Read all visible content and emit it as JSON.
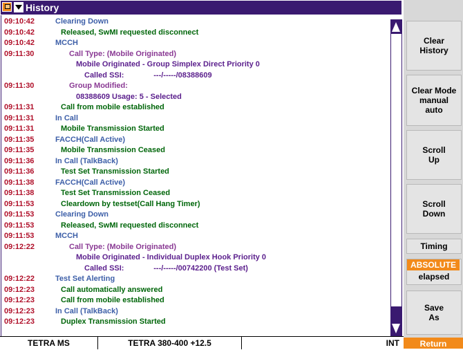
{
  "window": {
    "title": "History"
  },
  "log": [
    {
      "time": "09:10:42",
      "text": "Clearing Down",
      "color": "b",
      "indent": 0
    },
    {
      "time": "09:10:42",
      "text": "Released, SwMI requested disconnect",
      "color": "m",
      "indent": 1
    },
    {
      "time": "09:10:42",
      "text": "MCCH",
      "color": "b",
      "indent": 0
    },
    {
      "time": "09:11:30",
      "text": "Call Type: (Mobile Originated)",
      "color": "p",
      "indent": 2
    },
    {
      "time": "",
      "text": "Mobile Originated - Group Simplex Direct Priority 0",
      "color": "v",
      "indent": 3
    },
    {
      "time": "",
      "text": "Called SSI:              ---/-----/08388609",
      "color": "v",
      "indent": 4
    },
    {
      "time": "09:11:30",
      "text": "Group Modified:",
      "color": "p",
      "indent": 2
    },
    {
      "time": "",
      "text": "08388609 Usage: 5 - Selected",
      "color": "v",
      "indent": 3
    },
    {
      "time": "09:11:31",
      "text": "Call from mobile established",
      "color": "m",
      "indent": 1
    },
    {
      "time": "09:11:31",
      "text": "In Call",
      "color": "b",
      "indent": 0
    },
    {
      "time": "09:11:31",
      "text": "Mobile Transmission Started",
      "color": "m",
      "indent": 1
    },
    {
      "time": "09:11:35",
      "text": "FACCH(Call Active)",
      "color": "b",
      "indent": 0
    },
    {
      "time": "09:11:35",
      "text": "Mobile Transmission Ceased",
      "color": "m",
      "indent": 1
    },
    {
      "time": "09:11:36",
      "text": "In Call (TalkBack)",
      "color": "b",
      "indent": 0
    },
    {
      "time": "09:11:36",
      "text": "Test Set Transmission Started",
      "color": "m",
      "indent": 1
    },
    {
      "time": "09:11:38",
      "text": "FACCH(Call Active)",
      "color": "b",
      "indent": 0
    },
    {
      "time": "09:11:38",
      "text": "Test Set Transmission Ceased",
      "color": "m",
      "indent": 1
    },
    {
      "time": "09:11:53",
      "text": "Cleardown by testset(Call Hang Timer)",
      "color": "m",
      "indent": 1
    },
    {
      "time": "09:11:53",
      "text": "Clearing Down",
      "color": "b",
      "indent": 0
    },
    {
      "time": "09:11:53",
      "text": "Released, SwMI requested disconnect",
      "color": "m",
      "indent": 1
    },
    {
      "time": "09:11:53",
      "text": "MCCH",
      "color": "b",
      "indent": 0
    },
    {
      "time": "09:12:22",
      "text": "Call Type: (Mobile Originated)",
      "color": "p",
      "indent": 2
    },
    {
      "time": "",
      "text": "Mobile Originated - Individual Duplex Hook Priority 0",
      "color": "v",
      "indent": 3
    },
    {
      "time": "",
      "text": "Called SSI:              ---/-----/00742200 (Test Set)",
      "color": "v",
      "indent": 4
    },
    {
      "time": "09:12:22",
      "text": "Test Set Alerting",
      "color": "b",
      "indent": 0
    },
    {
      "time": "09:12:23",
      "text": "Call automatically answered",
      "color": "m",
      "indent": 1
    },
    {
      "time": "09:12:23",
      "text": "Call from mobile established",
      "color": "m",
      "indent": 1
    },
    {
      "time": "09:12:23",
      "text": "In Call (TalkBack)",
      "color": "b",
      "indent": 0
    },
    {
      "time": "09:12:23",
      "text": "Duplex Transmission Started",
      "color": "m",
      "indent": 1
    }
  ],
  "status": {
    "mode": "TETRA MS",
    "band": "TETRA 380-400 +12.5",
    "ref": "INT"
  },
  "softkeys": {
    "clear_history": [
      "Clear",
      "History"
    ],
    "clear_mode": [
      "Clear Mode",
      "manual",
      "auto"
    ],
    "scroll_up": [
      "Scroll",
      "Up"
    ],
    "scroll_down": [
      "Scroll",
      "Down"
    ],
    "timing_label": "Timing",
    "timing_selected": "ABSOLUTE",
    "timing_other": "elapsed",
    "save_as": [
      "Save",
      "As"
    ],
    "return": "Return"
  },
  "colors": {
    "titlebar": "#3a1a70",
    "accent": "#f28a1a",
    "time": "#b0102a",
    "green": "#00660a",
    "blue": "#3d5fa8",
    "purple": "#8a3a94"
  }
}
